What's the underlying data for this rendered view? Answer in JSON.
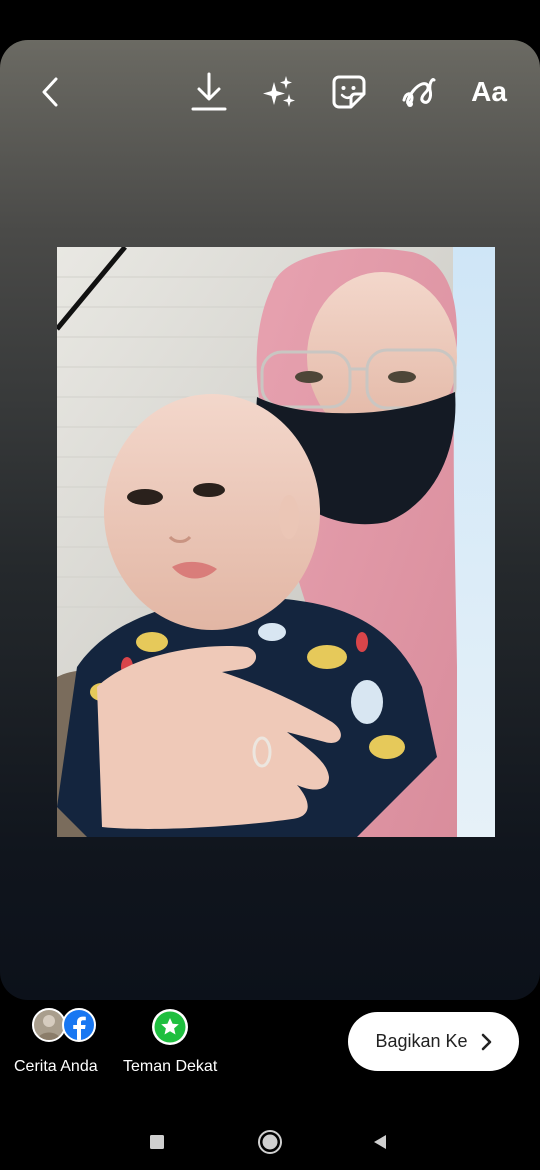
{
  "toolbar": {
    "back_icon": "chevron-left-icon",
    "download_icon": "download-icon",
    "effects_icon": "sparkles-icon",
    "sticker_icon": "sticker-icon",
    "draw_icon": "scribble-icon",
    "text_label": "Aa"
  },
  "photo": {
    "description_icon": "photo"
  },
  "share_targets": [
    {
      "label": "Cerita Anda"
    },
    {
      "label": "Teman Dekat"
    }
  ],
  "share_button": {
    "label": "Bagikan Ke"
  },
  "colors": {
    "close_friends": "#1fbf3f",
    "facebook": "#1877f2",
    "button_bg": "#ffffff"
  }
}
